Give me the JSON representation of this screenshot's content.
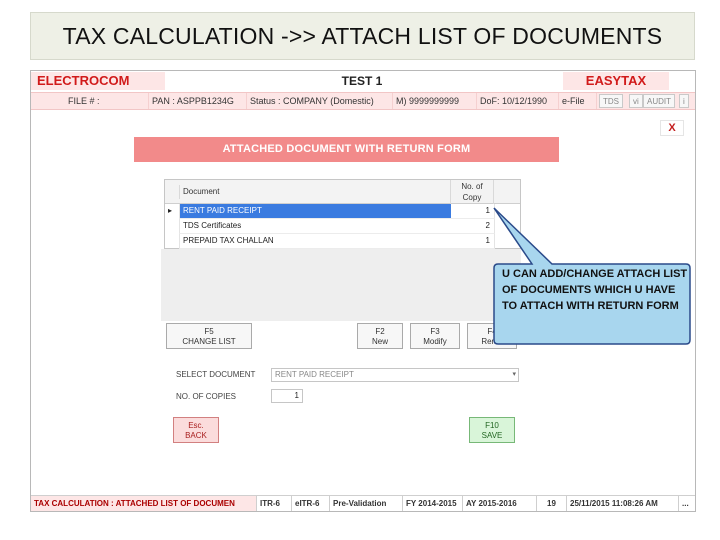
{
  "slide": {
    "title": "TAX CALCULATION ->> ATTACH LIST OF DOCUMENTS"
  },
  "brand": {
    "left": "ELECTROCOM",
    "center": "TEST 1",
    "right": "EASYTAX"
  },
  "info": {
    "file": "FILE # :",
    "pan": "PAN : ASPPB1234G",
    "status": "Status : COMPANY (Domestic)",
    "mobile": "M) 9999999999",
    "dof": "DoF: 10/12/1990",
    "efile": "e-File",
    "tabs": [
      "TDS",
      "vi",
      "AUDIT",
      "i"
    ]
  },
  "close_label": "X",
  "panel_title": "ATTACHED DOCUMENT WITH RETURN FORM",
  "grid": {
    "headers": {
      "document": "Document",
      "copies_line1": "No. of",
      "copies_line2": "Copy"
    },
    "row_marker": "▸",
    "rows": [
      {
        "document": "RENT PAID RECEIPT",
        "copies": "1"
      },
      {
        "document": "TDS Certificates",
        "copies": "2"
      },
      {
        "document": "PREPAID TAX CHALLAN",
        "copies": "1"
      }
    ]
  },
  "buttons": {
    "change_list": {
      "key": "F5",
      "label": "CHANGE LIST"
    },
    "new": {
      "key": "F2",
      "label": "New"
    },
    "modify": {
      "key": "F3",
      "label": "Modify"
    },
    "remove": {
      "key": "F4",
      "label": "Remo"
    },
    "back": {
      "key": "Esc.",
      "label": "BACK"
    },
    "save": {
      "key": "F10",
      "label": "SAVE"
    }
  },
  "form": {
    "select_label": "SELECT DOCUMENT",
    "select_value": "RENT PAID RECEIPT",
    "copies_label": "NO. OF COPIES",
    "copies_value": "1"
  },
  "callout": "U CAN ADD/CHANGE ATTACH LIST OF DOCUMENTS WHICH U HAVE TO ATTACH WITH RETURN FORM",
  "statusbar": {
    "screen": "TAX CALCULATION : ATTACHED LIST OF DOCUMEN",
    "itr": "ITR-6",
    "eitr": "eITR-6",
    "prevalidation": "Pre-Validation",
    "fy": "FY 2014-2015",
    "ay": "AY 2015-2016",
    "num": "19",
    "datetime": "25/11/2015 11:08:26 AM",
    "more": "..."
  },
  "colors": {
    "brand_red": "#d11a1a",
    "pink_bg": "#fde6e6",
    "panel_salmon": "#f28a8a",
    "selection_blue": "#3a7be0",
    "callout_fill": "#a8d6ee",
    "callout_stroke": "#2a4a8a"
  }
}
